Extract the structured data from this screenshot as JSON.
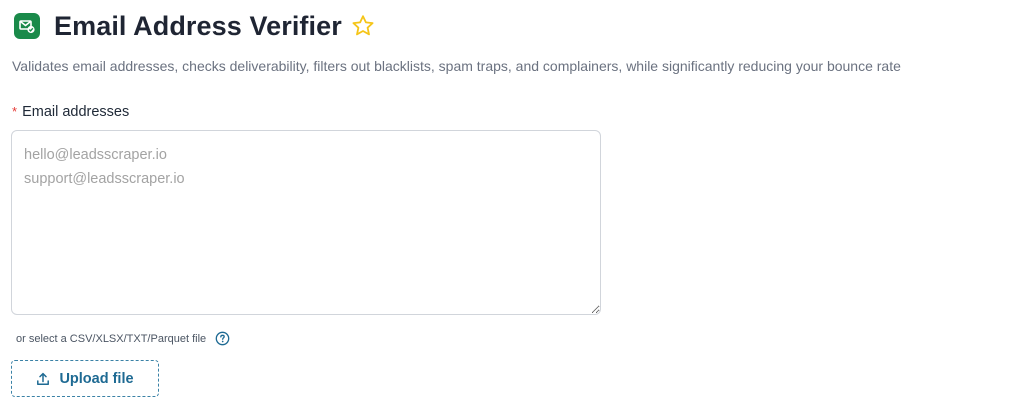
{
  "header": {
    "app_icon": "envelope-check-icon",
    "title": "Email Address Verifier",
    "favorite_icon": "star-outline-icon",
    "star_color": "#f5c518",
    "subtitle": "Validates email addresses, checks deliverability, filters out blacklists, spam traps, and complainers, while significantly reducing your bounce rate"
  },
  "form": {
    "required_marker": "*",
    "email_label": "Email addresses",
    "email_value": "",
    "email_placeholder": "hello@leadsscraper.io\nsupport@leadsscraper.io",
    "file_hint": "or select a CSV/XLSX/TXT/Parquet file",
    "help_icon": "question-circle-icon",
    "upload_icon": "upload-icon",
    "upload_label": "Upload file"
  },
  "colors": {
    "brand_green": "#1a8a4a",
    "accent_blue": "#1e6a93",
    "required_red": "#e53935"
  }
}
